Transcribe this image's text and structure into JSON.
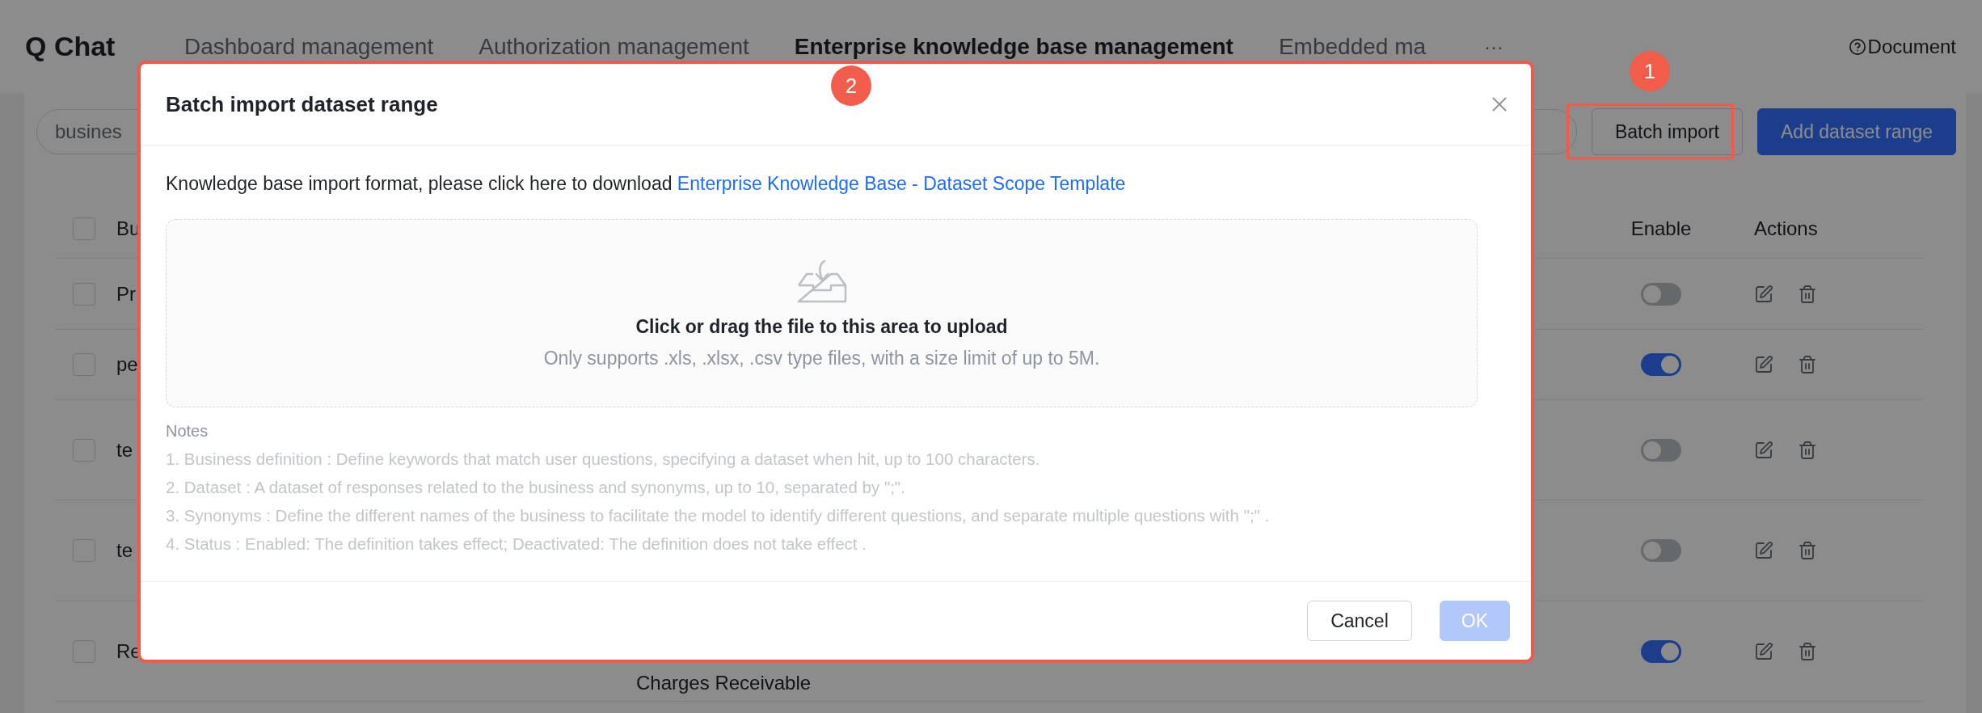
{
  "app": {
    "title": "Q Chat"
  },
  "tabs": [
    {
      "label": "Dashboard management",
      "selected": false
    },
    {
      "label": "Authorization management",
      "selected": false
    },
    {
      "label": "Enterprise knowledge base management",
      "selected": true
    },
    {
      "label": "Embedded ma",
      "selected": false
    }
  ],
  "more": "···",
  "document": "Document",
  "toolbar": {
    "search": {
      "value": "busines"
    },
    "batch_import": "Batch import",
    "add": "Add dataset range"
  },
  "table": {
    "columns": [
      "Bu",
      "Enable",
      "Actions"
    ],
    "header_checked": false,
    "rows": [
      {
        "name": "Pr",
        "checked": false,
        "enabled": false
      },
      {
        "name": "pe",
        "checked": false,
        "enabled": true
      },
      {
        "name": "te",
        "checked": false,
        "enabled": false
      },
      {
        "name": "te",
        "checked": false,
        "enabled": false
      },
      {
        "name": "Re",
        "column_3": "Charges Receivable",
        "checked": false,
        "enabled": true
      }
    ]
  },
  "dialog": {
    "title": "Batch import dataset range",
    "intro": "Knowledge base import format, please click here to download ",
    "template_link": "Enterprise Knowledge Base - Dataset Scope Template",
    "dropzone": {
      "title": "Click or drag the file to this area to upload",
      "hint": "Only supports .xls, .xlsx, .csv type files, with a size limit of up to 5M."
    },
    "notes_title": "Notes",
    "notes": [
      "1. Business definition : Define keywords that match user questions, specifying a dataset when hit, up to 100 characters.",
      "2. Dataset : A dataset of responses related to the business and synonyms, up to 10, separated by \";\".",
      "3. Synonyms : Define the different names of the business to facilitate the model to identify different questions, and separate multiple questions with \";\" .",
      "4. Status : Enabled: The definition takes effect; Deactivated: The definition does not take effect ."
    ],
    "buttons": [
      {
        "label": "Cancel",
        "kind": "default",
        "disabled": false
      },
      {
        "label": "OK",
        "kind": "primary",
        "disabled": true
      }
    ]
  },
  "annotations": [
    {
      "label": "1"
    },
    {
      "label": "2"
    }
  ]
}
